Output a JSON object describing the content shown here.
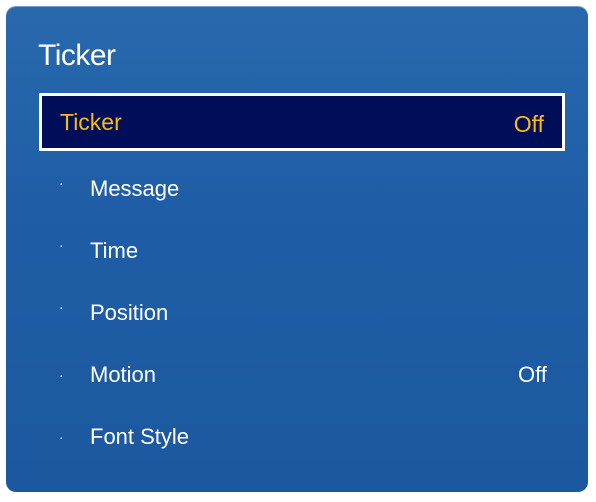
{
  "menu": {
    "title": "Ticker",
    "selected": {
      "label": "Ticker",
      "value": "Off"
    },
    "items": [
      {
        "label": "Message",
        "value": ""
      },
      {
        "label": "Time",
        "value": ""
      },
      {
        "label": "Position",
        "value": ""
      },
      {
        "label": "Motion",
        "value": "Off"
      },
      {
        "label": "Font Style",
        "value": ""
      }
    ],
    "bullet_glyph": "·"
  },
  "colors": {
    "panel_background": "#1f5ea6",
    "selected_background": "#000e5a",
    "selected_text": "#f8b919",
    "text": "#ffffff"
  }
}
